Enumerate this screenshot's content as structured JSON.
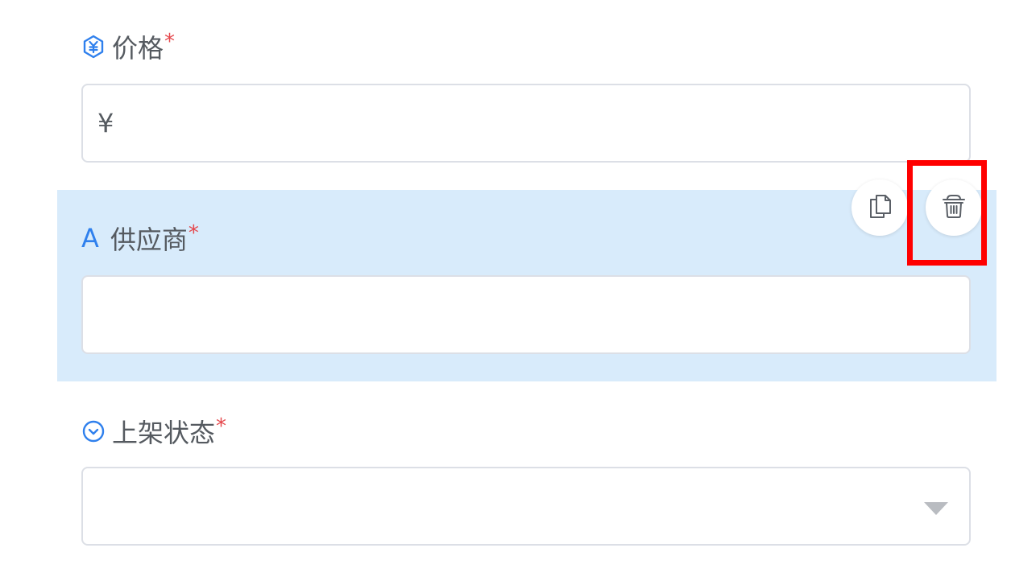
{
  "fields": [
    {
      "label": "价格",
      "required_mark": "*",
      "icon": "yen-circle-icon",
      "input": {
        "prefix": "¥",
        "value": ""
      }
    },
    {
      "label": "供应商",
      "required_mark": "*",
      "icon": "text-letter-a-icon",
      "icon_glyph": "A",
      "input": {
        "value": ""
      },
      "selected": true
    },
    {
      "label": "上架状态",
      "required_mark": "*",
      "icon": "chevron-down-circle-icon",
      "input": {
        "value": "",
        "type": "select"
      }
    }
  ],
  "actions": {
    "copy": "copy-icon",
    "delete": "trash-icon"
  },
  "colors": {
    "accent": "#2f80ed",
    "required": "#e5484d",
    "selected_bg": "#d8ebfb",
    "highlight": "#ff0000",
    "label": "#555a60"
  }
}
